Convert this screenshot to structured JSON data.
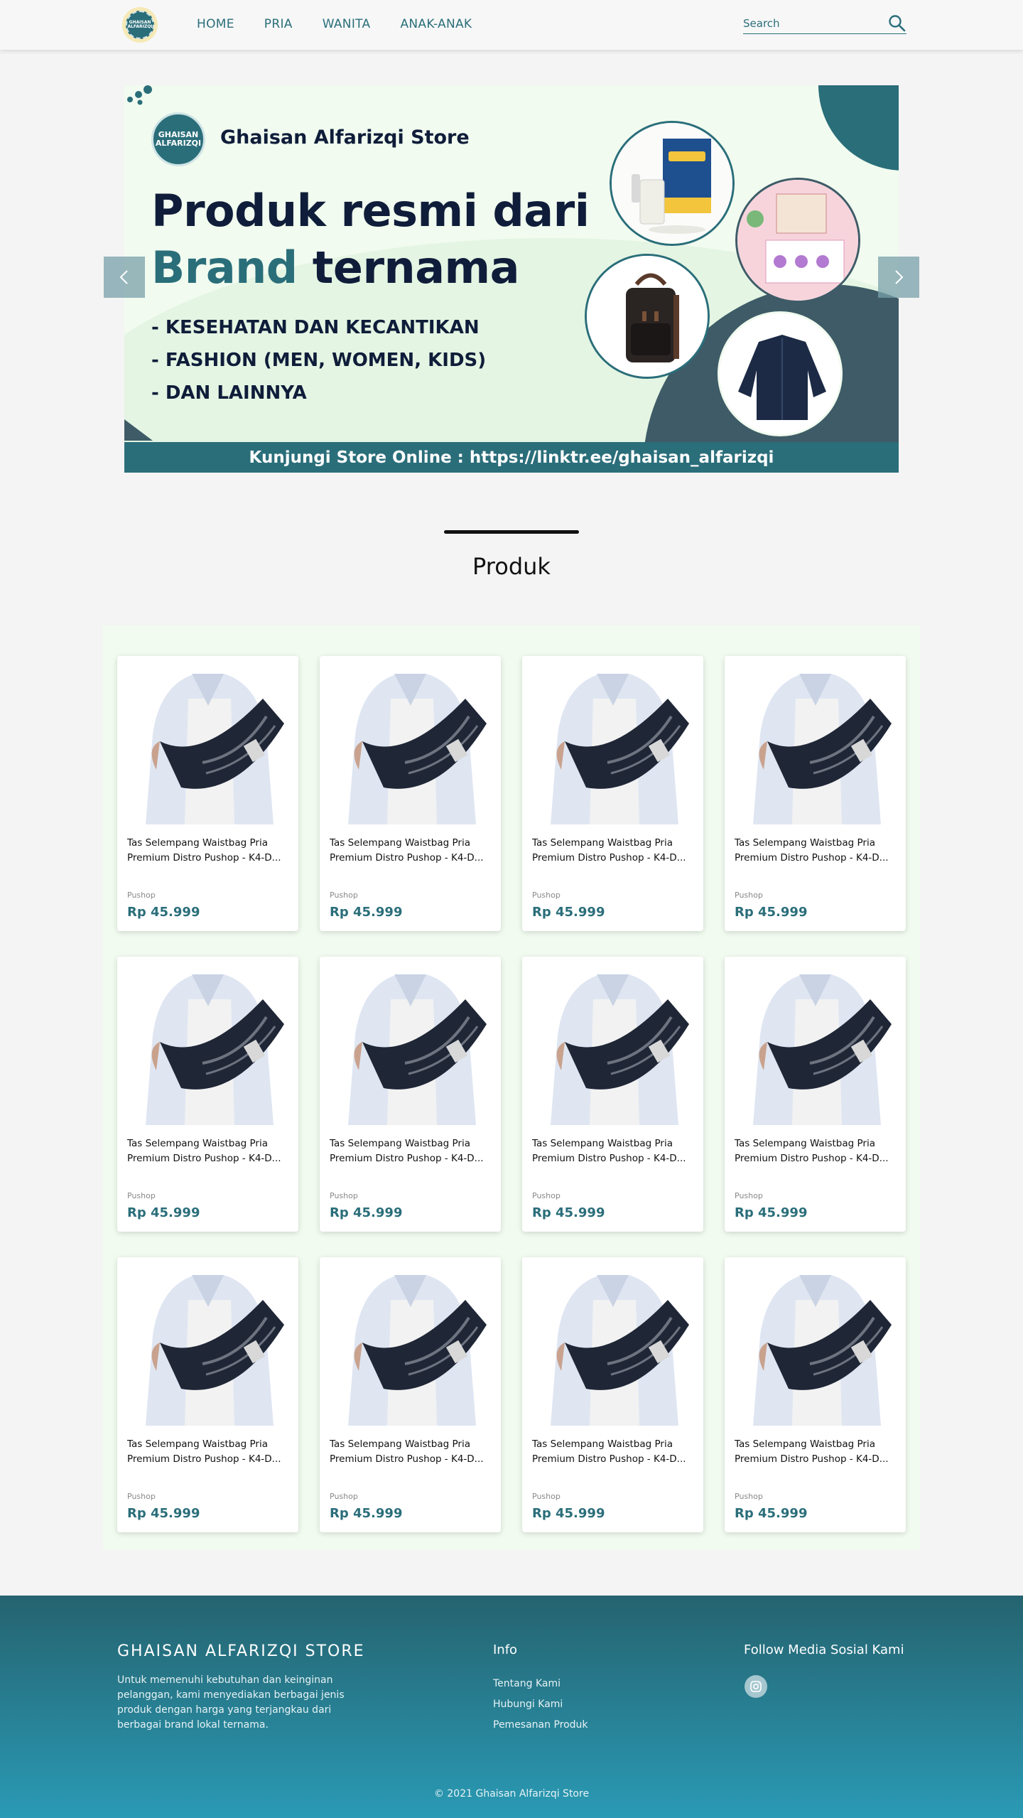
{
  "nav": {
    "logo_text": "GHAISAN ALFARIZQI",
    "links": [
      "HOME",
      "PRIA",
      "WANITA",
      "ANAK-ANAK"
    ],
    "search_placeholder": "Search"
  },
  "banner": {
    "logo_text": "GHAISAN ALFARIZQI",
    "store_name": "Ghaisan Alfarizqi Store",
    "headline_line1": "Produk resmi dari",
    "headline_accent": "Brand",
    "headline_rest": " ternama",
    "list": [
      "- KESEHATAN DAN KECANTIKAN",
      "- FASHION (MEN, WOMEN, KIDS)",
      "- DAN LAINNYA"
    ],
    "footer_text": "Kunjungi Store Online : https://linktr.ee/ghaisan_alfarizqi"
  },
  "section": {
    "title": "Produk"
  },
  "products": [
    {
      "name": "Tas Selempang Waistbag Pria Premium Distro Pushop - K4-D...",
      "shop": "Pushop",
      "price": "Rp 45.999"
    },
    {
      "name": "Tas Selempang Waistbag Pria Premium Distro Pushop - K4-D...",
      "shop": "Pushop",
      "price": "Rp 45.999"
    },
    {
      "name": "Tas Selempang Waistbag Pria Premium Distro Pushop - K4-D...",
      "shop": "Pushop",
      "price": "Rp 45.999"
    },
    {
      "name": "Tas Selempang Waistbag Pria Premium Distro Pushop - K4-D...",
      "shop": "Pushop",
      "price": "Rp 45.999"
    },
    {
      "name": "Tas Selempang Waistbag Pria Premium Distro Pushop - K4-D...",
      "shop": "Pushop",
      "price": "Rp 45.999"
    },
    {
      "name": "Tas Selempang Waistbag Pria Premium Distro Pushop - K4-D...",
      "shop": "Pushop",
      "price": "Rp 45.999"
    },
    {
      "name": "Tas Selempang Waistbag Pria Premium Distro Pushop - K4-D...",
      "shop": "Pushop",
      "price": "Rp 45.999"
    },
    {
      "name": "Tas Selempang Waistbag Pria Premium Distro Pushop - K4-D...",
      "shop": "Pushop",
      "price": "Rp 45.999"
    },
    {
      "name": "Tas Selempang Waistbag Pria Premium Distro Pushop - K4-D...",
      "shop": "Pushop",
      "price": "Rp 45.999"
    },
    {
      "name": "Tas Selempang Waistbag Pria Premium Distro Pushop - K4-D...",
      "shop": "Pushop",
      "price": "Rp 45.999"
    },
    {
      "name": "Tas Selempang Waistbag Pria Premium Distro Pushop - K4-D...",
      "shop": "Pushop",
      "price": "Rp 45.999"
    },
    {
      "name": "Tas Selempang Waistbag Pria Premium Distro Pushop - K4-D...",
      "shop": "Pushop",
      "price": "Rp 45.999"
    }
  ],
  "footer": {
    "brand": "GHAISAN ALFARIZQI STORE",
    "description": "Untuk memenuhi kebutuhan dan keinginan pelanggan, kami menyediakan berbagai  jenis produk dengan harga yang terjangkau dari berbagai brand lokal ternama.",
    "info_title": "Info",
    "links": [
      "Tentang Kami",
      "Hubungi Kami",
      "Pemesanan Produk"
    ],
    "follow_title": "Follow Media Sosial Kami",
    "social_icon": "instagram-icon",
    "copyright": "2021 Ghaisan Alfarizqi Store"
  },
  "colors": {
    "accent": "#2a6e7a",
    "navy": "#0f1d3a",
    "banner_bg": "#f1fbef",
    "price": "#2a6e7a"
  }
}
